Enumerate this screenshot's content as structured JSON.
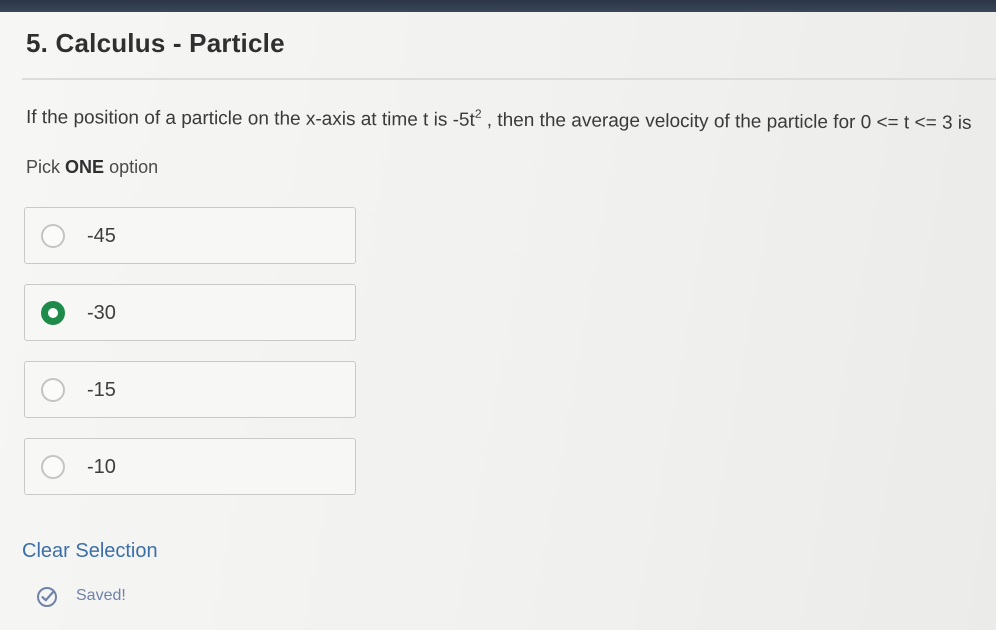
{
  "question": {
    "title": "5. Calculus - Particle",
    "text_before": "If the position of a particle on the x-axis at time t is -5t",
    "exponent": "2",
    "text_after": " , then the average velocity of the particle for 0 <= t <= 3 is",
    "instruction_prefix": "Pick",
    "instruction_emphasis": "ONE",
    "instruction_suffix": "option"
  },
  "options": [
    {
      "label": "-45",
      "selected": false
    },
    {
      "label": "-30",
      "selected": true
    },
    {
      "label": "-15",
      "selected": false
    },
    {
      "label": "-10",
      "selected": false
    }
  ],
  "actions": {
    "clear_label": "Clear Selection"
  },
  "status": {
    "saved_label": "Saved!",
    "icon": "check-circle-icon"
  },
  "colors": {
    "selected_radio": "#1e8b4a",
    "link": "#3c6fa8",
    "saved": "#6f82a8"
  }
}
